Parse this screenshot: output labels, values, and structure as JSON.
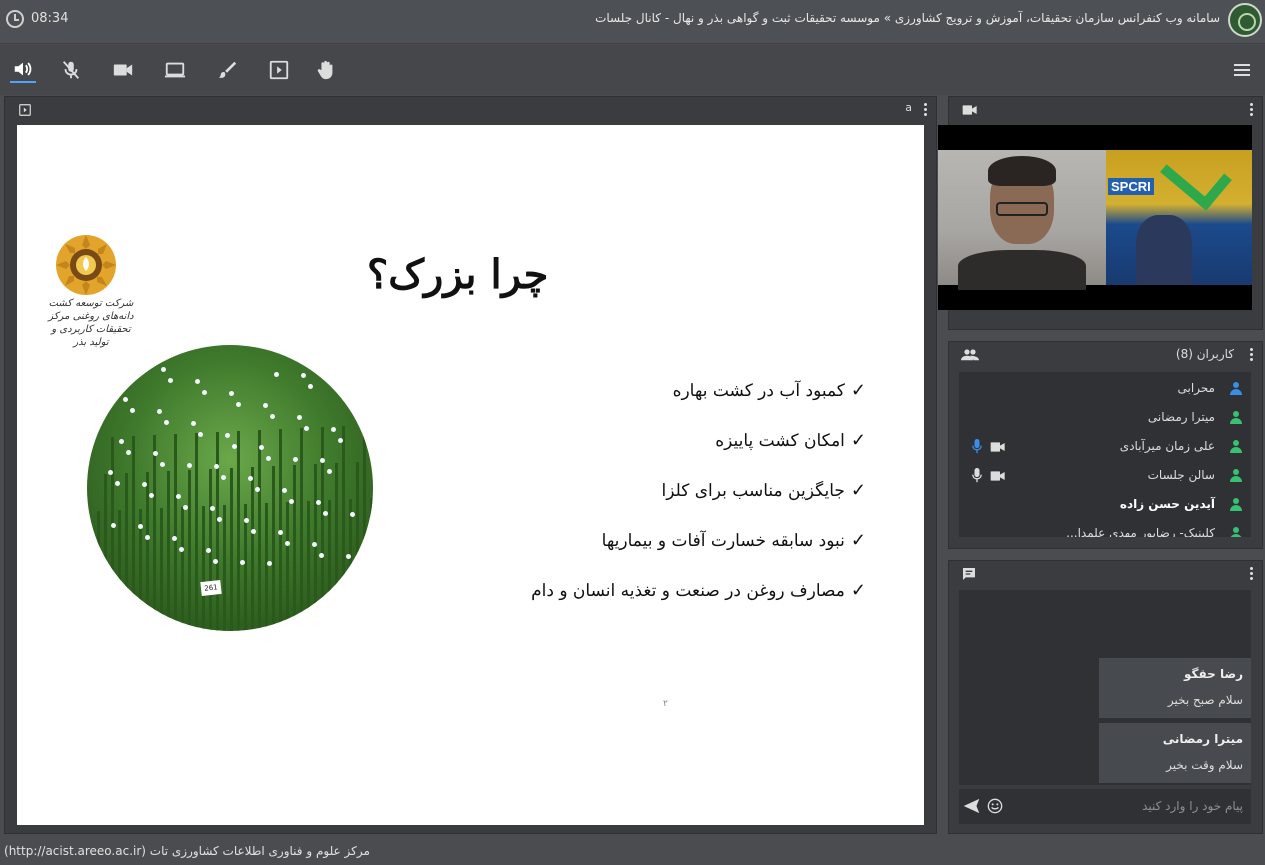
{
  "header": {
    "title": "سامانه وب کنفرانس سازمان تحقیقات، آموزش و ترویج کشاورزی » موسسه تحقیقات ثبت و گواهی بذر و نهال - کانال جلسات",
    "time": "08:34"
  },
  "toolbar": {
    "icons": [
      "speaker-icon",
      "mic-off-icon",
      "camera-icon",
      "screen-share-icon",
      "brush-icon",
      "presentation-icon",
      "raise-hand-icon"
    ],
    "accent": "#4ea3ff"
  },
  "presentation": {
    "panel_label": "a",
    "slide": {
      "heading": "چرا بزرک؟",
      "bullets": [
        "کمبود آب در کشت بهاره",
        "امکان کشت پاییزه",
        "جایگزین مناسب برای کلزا",
        "نبود سابقه خسارت آفات و بیماریها",
        "مصارف روغن در صنعت و تغذیه انسان و دام"
      ],
      "check": "✓",
      "page_number": "۲",
      "plot_tag": "261",
      "logo_text": "شرکت توسعه کشت دانه‌های روغنی مرکز تحقیقات کاربردی و تولید بذر"
    }
  },
  "video": {
    "banner": "SPCRI"
  },
  "users": {
    "title": "کاربران (8)",
    "list": [
      {
        "name": "محرابی",
        "color": "#3a8ee6",
        "bold": false,
        "mic": false,
        "cam": false
      },
      {
        "name": "میترا رمضانی",
        "color": "#38c172",
        "bold": false,
        "mic": false,
        "cam": false
      },
      {
        "name": "علی زمان میرآبادی",
        "color": "#38c172",
        "bold": false,
        "mic": true,
        "cam": true,
        "mic_color": "#3a8ee6"
      },
      {
        "name": "سالن جلسات",
        "color": "#38c172",
        "bold": false,
        "mic": true,
        "cam": true,
        "mic_color": "#dddddd"
      },
      {
        "name": "آیدین حسن زاده",
        "color": "#38c172",
        "bold": true,
        "mic": false,
        "cam": false
      },
      {
        "name": "کلینیک- رضاپور مهدی علمدا...",
        "color": "#38c172",
        "bold": false,
        "mic": false,
        "cam": false
      }
    ]
  },
  "chat": {
    "messages": [
      {
        "author": "رضا حقگو",
        "text": "سلام صبح بخیر"
      },
      {
        "author": "میترا رمضانی",
        "text": "سلام وقت بخیر"
      }
    ],
    "placeholder": "پیام خود را وارد کنید"
  },
  "footer": {
    "text": "مرکز علوم و فناوری اطلاعات کشاورزی تات (http://acist.areeo.ac.ir)"
  }
}
